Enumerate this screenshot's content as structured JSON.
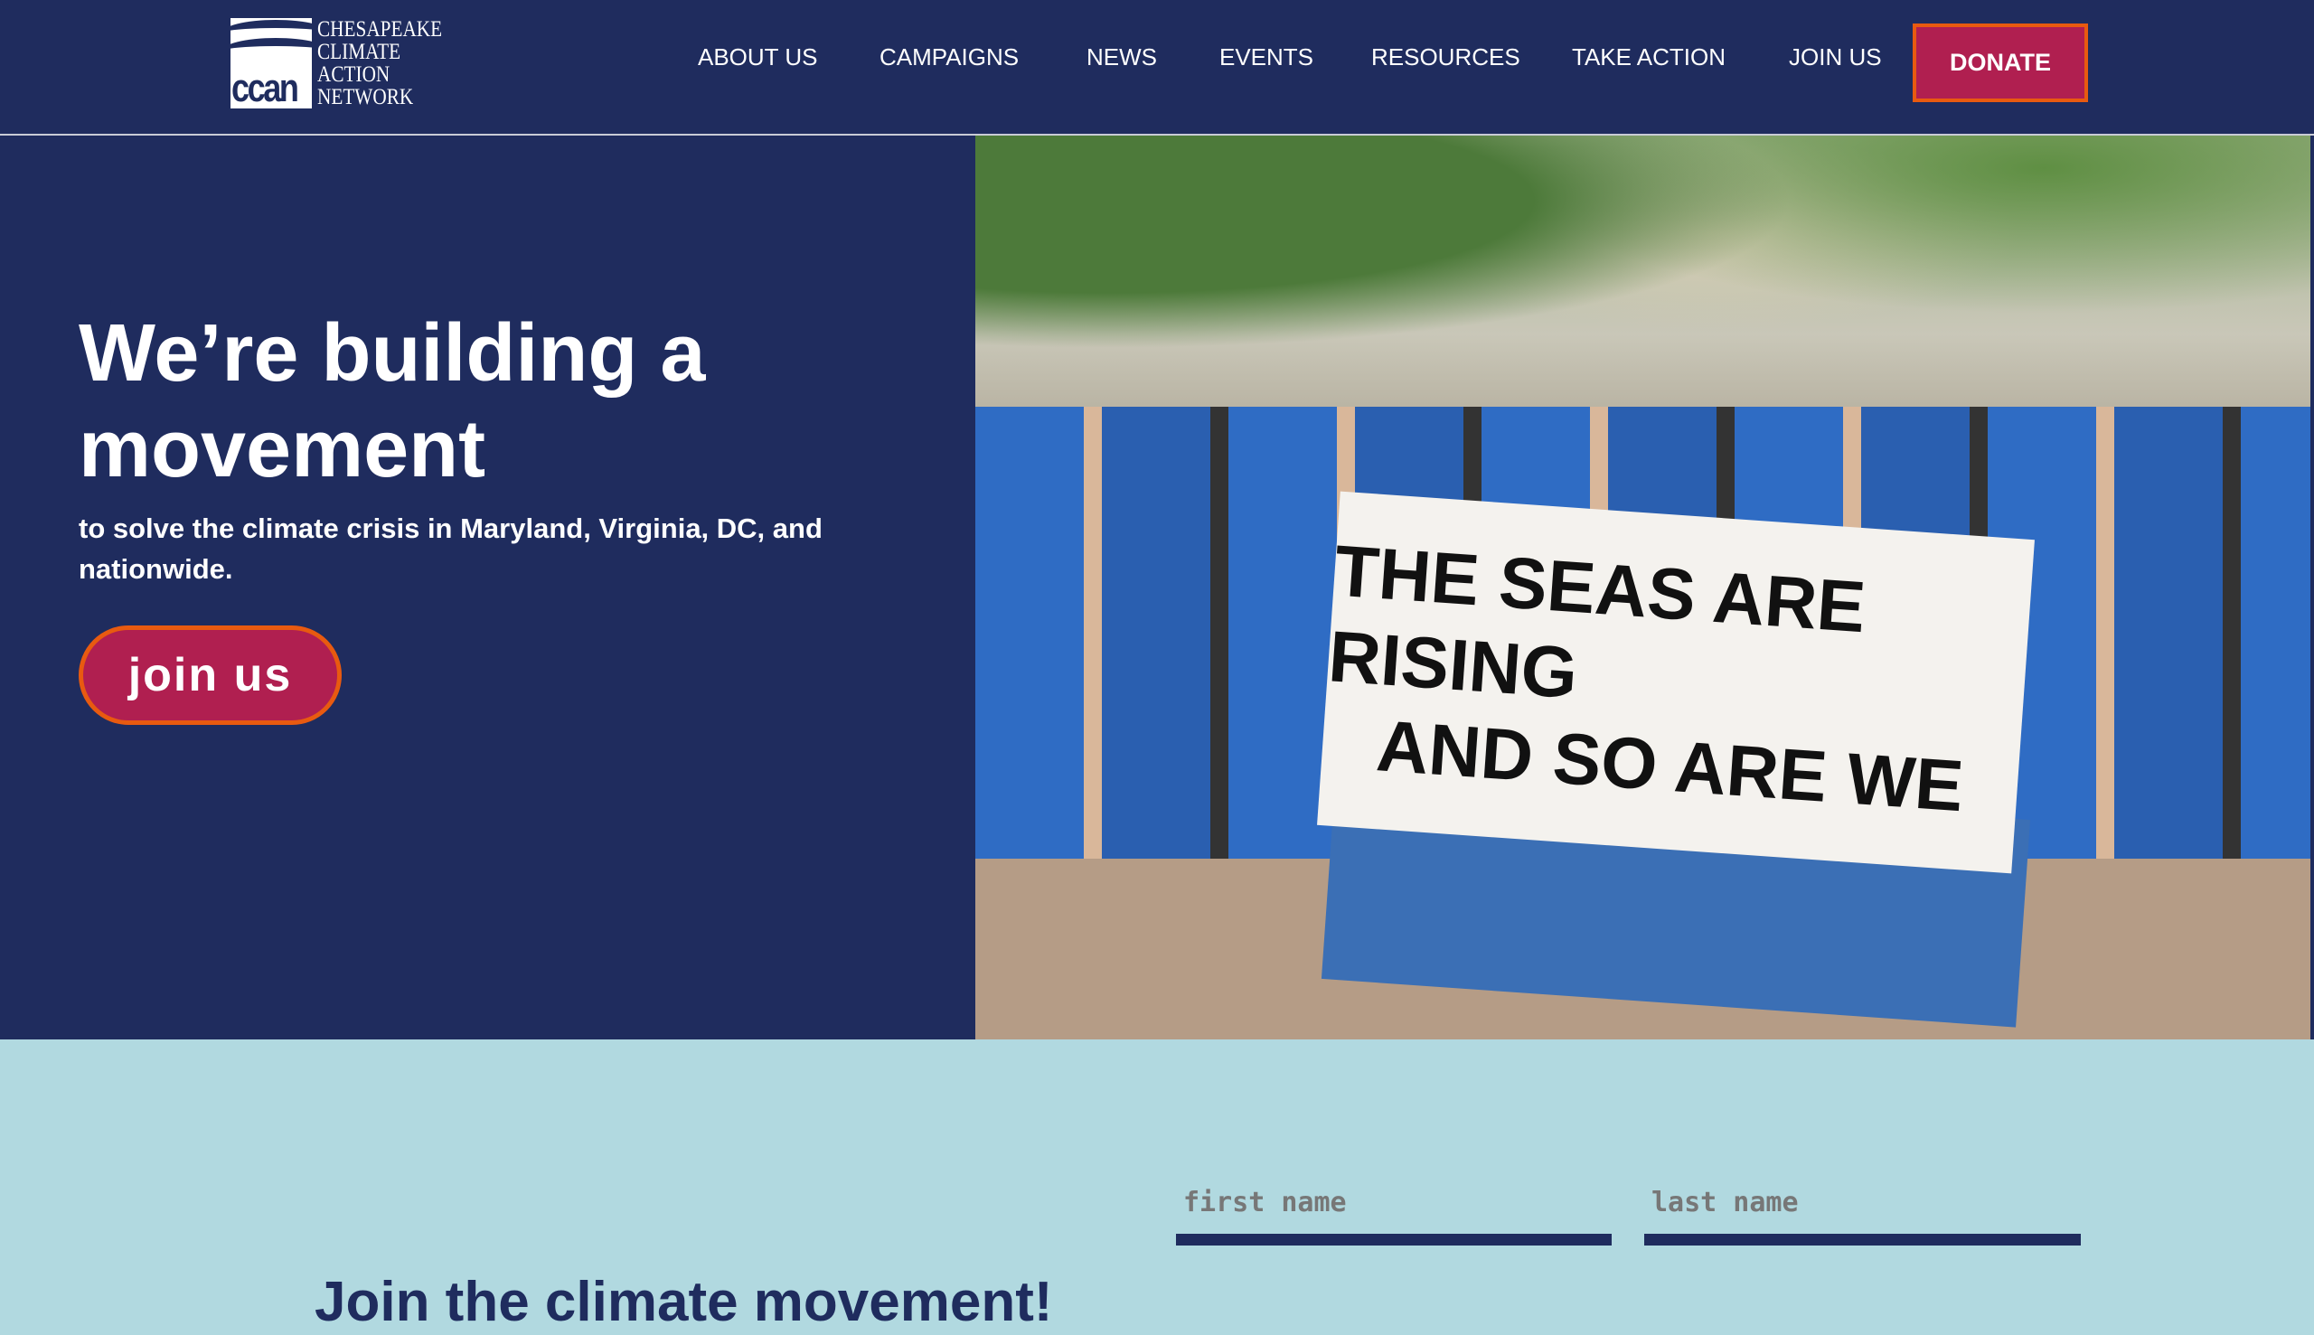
{
  "header": {
    "logo": {
      "abbr": "ccan",
      "lines": [
        "CHESAPEAKE",
        "CLIMATE",
        "ACTION",
        "NETWORK"
      ]
    },
    "nav": [
      "ABOUT US",
      "CAMPAIGNS",
      "NEWS",
      "EVENTS",
      "RESOURCES",
      "TAKE ACTION",
      "JOIN US"
    ],
    "donate_label": "DONATE"
  },
  "hero": {
    "title": "We’re building a movement",
    "subtitle": "to solve the climate crisis in Maryland, Virginia, DC, and nationwide.",
    "cta_label": "join us",
    "photo_banner": [
      "THE SEAS ARE RISING",
      "AND SO ARE WE"
    ]
  },
  "signup": {
    "first_name_placeholder": "first name",
    "last_name_placeholder": "last name",
    "heading": "Join the climate movement!"
  },
  "colors": {
    "navy": "#1f2c5e",
    "crimson": "#b01f50",
    "orange": "#e85a10",
    "light_blue": "#b1d9e0"
  }
}
